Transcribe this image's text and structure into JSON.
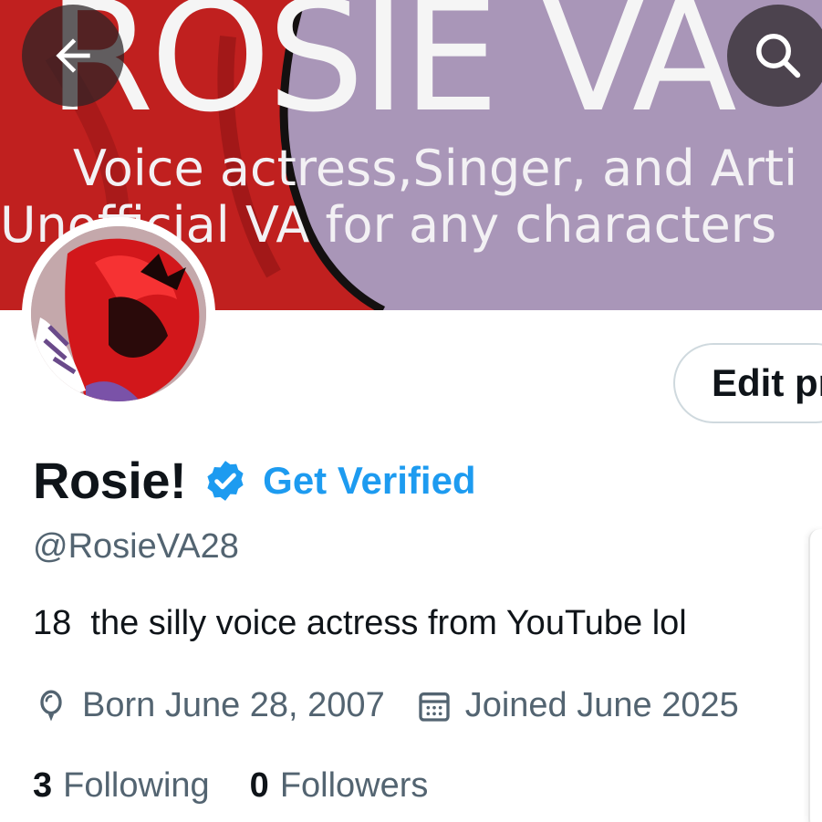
{
  "banner": {
    "title": "ROSIE VA",
    "line1": "Voice actress,Singer, and Arti",
    "line2": "Unofficial VA for any characters"
  },
  "nav": {
    "back_icon": "arrow-left-icon",
    "search_icon": "search-icon"
  },
  "profile": {
    "edit_label": "Edit pr",
    "display_name": "Rosie!",
    "verified_icon": "verified-badge-icon",
    "get_verified_label": "Get Verified",
    "handle": "@RosieVA28",
    "bio": "18  the silly voice actress from YouTube lol",
    "birthday": "Born June 28, 2007",
    "joined": "Joined June 2025",
    "following_count": "3",
    "following_label": "Following",
    "followers_count": "0",
    "followers_label": "Followers"
  },
  "colors": {
    "accent": "#1d9bf0",
    "secondary_text": "#536471",
    "banner_purple": "#a996b8",
    "banner_red": "#c0201f"
  }
}
